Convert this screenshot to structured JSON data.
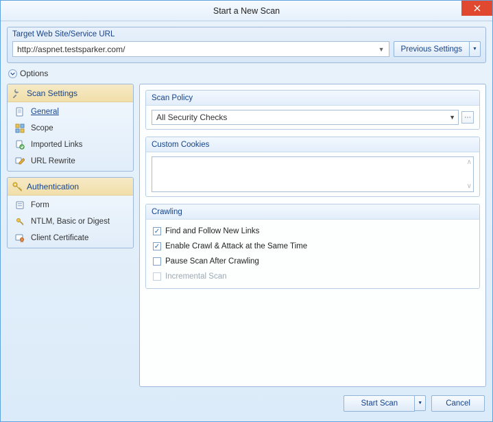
{
  "title": "Start a New Scan",
  "target": {
    "label": "Target Web Site/Service URL",
    "url": "http://aspnet.testsparker.com/",
    "previous_btn": "Previous Settings"
  },
  "options_label": "Options",
  "sidebar": {
    "scan_settings": {
      "header": "Scan Settings",
      "items": [
        {
          "label": "General",
          "selected": true
        },
        {
          "label": "Scope"
        },
        {
          "label": "Imported Links"
        },
        {
          "label": "URL Rewrite"
        }
      ]
    },
    "authentication": {
      "header": "Authentication",
      "items": [
        {
          "label": "Form"
        },
        {
          "label": "NTLM, Basic or Digest"
        },
        {
          "label": "Client Certificate"
        }
      ]
    }
  },
  "scan_policy": {
    "header": "Scan Policy",
    "value": "All Security Checks"
  },
  "custom_cookies": {
    "header": "Custom Cookies",
    "value": ""
  },
  "crawling": {
    "header": "Crawling",
    "items": [
      {
        "label": "Find and Follow New Links",
        "checked": true,
        "enabled": true
      },
      {
        "label": "Enable Crawl & Attack at the Same Time",
        "checked": true,
        "enabled": true
      },
      {
        "label": "Pause Scan After Crawling",
        "checked": false,
        "enabled": true
      },
      {
        "label": "Incremental Scan",
        "checked": false,
        "enabled": false
      }
    ]
  },
  "footer": {
    "start": "Start Scan",
    "cancel": "Cancel"
  }
}
